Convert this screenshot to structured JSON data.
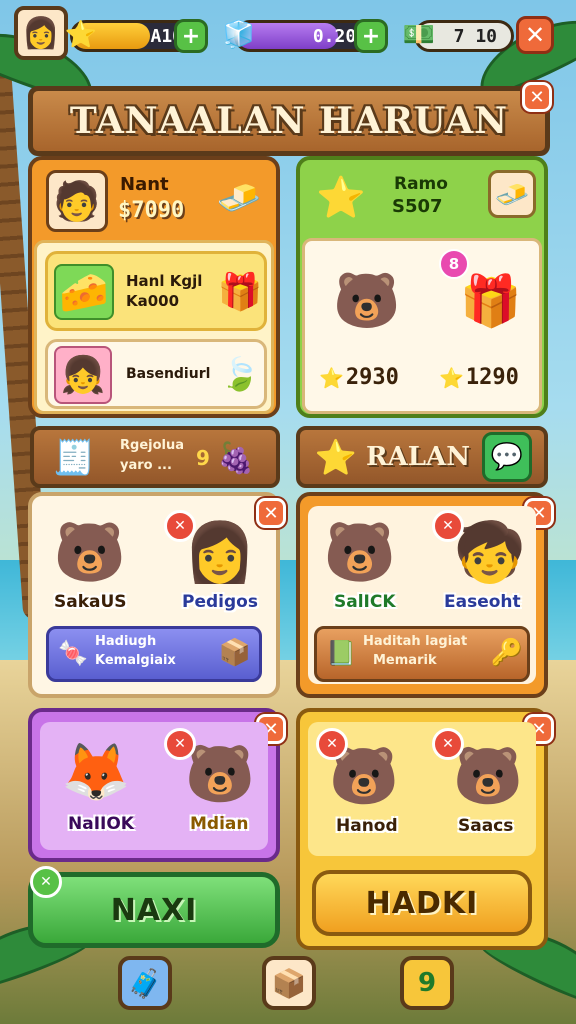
{
  "hud": {
    "avatar_icon": "👩",
    "gold": {
      "icon": "⭐",
      "value": "A10",
      "plus": "+"
    },
    "gems": {
      "icon": "🧊",
      "value": "0.200",
      "plus": "+"
    },
    "cash": {
      "icon": "💵",
      "value": "7 10"
    },
    "close": "✕"
  },
  "title": {
    "text": "TANAALAN HARUAN",
    "close": "✕"
  },
  "profile_panel": {
    "avatar_icon": "🧑",
    "name": "Nant",
    "amount": "$7090",
    "reward_icon": "🧈",
    "card1": {
      "icon_left": "🧀",
      "line1": "Hanl Kgjl",
      "line2": "Ka000",
      "icon_right": "🎁"
    },
    "card2": {
      "avatar_icon": "👧",
      "label": "Basendiurl",
      "icon_right": "🍃"
    }
  },
  "shop_panel": {
    "star_icon": "⭐",
    "line1": "Ramo",
    "line2": "S507",
    "reward_icon": "🧈",
    "badge": "8",
    "item1_icon": "🐻",
    "item2_icon": "🎁",
    "price1": "2930",
    "price2": "1290",
    "coin_icon": "⭐"
  },
  "left_plank": {
    "icon": "🧾",
    "line1": "Rgejolua",
    "line2": "yaro ...",
    "num": "9",
    "icon_right": "🍇"
  },
  "right_plank": {
    "star_icon": "⭐",
    "label": "RALAN",
    "icon_right": "💬"
  },
  "team1": {
    "close": "✕",
    "char1": {
      "icon": "🐻",
      "name": "SakaUS"
    },
    "char2": {
      "icon": "👩",
      "name": "Pedigos",
      "badge": "✕"
    },
    "banner": {
      "icon_left": "🍬",
      "line1": "Hadiugh",
      "line2": "Kemalgiaix",
      "icon_right": "📦"
    }
  },
  "team2": {
    "close": "✕",
    "char1": {
      "icon": "🐻",
      "name": "SalICK"
    },
    "char2": {
      "icon": "🧒",
      "name": "Easeoht",
      "badge": "✕"
    },
    "banner": {
      "icon_left": "📗",
      "line1": "Haditah lagiat",
      "line2": "Memarik",
      "icon_right": "🔑"
    }
  },
  "team3": {
    "close": "✕",
    "char1": {
      "icon": "🦊",
      "name": "NaIIOK"
    },
    "char2": {
      "icon": "🐻",
      "name": "Mdian",
      "badge": "✕"
    }
  },
  "team4": {
    "close": "✕",
    "char1": {
      "icon": "🐻",
      "name": "Hanod",
      "badge": "✕"
    },
    "char2": {
      "icon": "🐻",
      "name": "Saacs",
      "badge": "✕"
    }
  },
  "buttons": {
    "left": "NAXI",
    "left_badge": "✕",
    "right": "HADKI"
  },
  "dock": {
    "item1": "🧳",
    "item2": "📦",
    "item3": "9"
  },
  "colors": {
    "orange": "#f39a2a",
    "green": "#8ed24a",
    "purple": "#c874e8",
    "yellow": "#f7c63a",
    "wood": "#a8652c",
    "close": "#ef6a3a"
  }
}
